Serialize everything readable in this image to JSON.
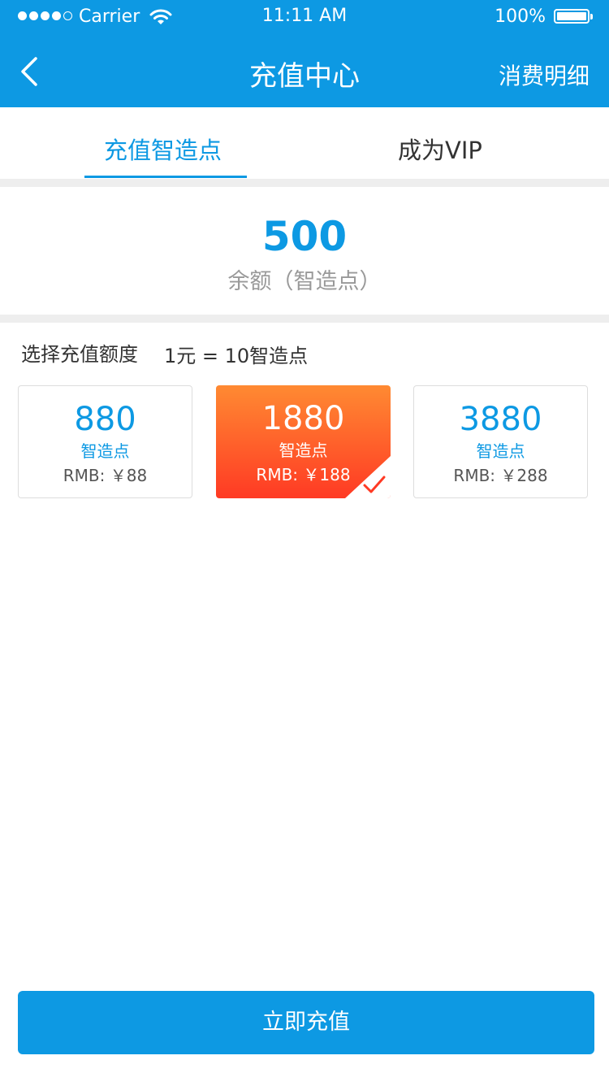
{
  "status_bar": {
    "carrier": "Carrier",
    "time": "11:11 AM",
    "battery": "100%",
    "signal_bars": 4,
    "signal_total": 5
  },
  "nav": {
    "title": "充值中心",
    "right_action": "消费明细"
  },
  "tabs": [
    {
      "label": "充值智造点",
      "active": true
    },
    {
      "label": "成为VIP",
      "active": false
    }
  ],
  "balance": {
    "value": "500",
    "label": "余额（智造点）"
  },
  "recharge": {
    "select_label": "选择充值额度",
    "rate": "1元 = 10智造点",
    "options": [
      {
        "amount": "880",
        "unit": "智造点",
        "price": "RMB: ￥88",
        "selected": false
      },
      {
        "amount": "1880",
        "unit": "智造点",
        "price": "RMB: ￥188",
        "selected": true
      },
      {
        "amount": "3880",
        "unit": "智造点",
        "price": "RMB: ￥288",
        "selected": false
      }
    ]
  },
  "cta_label": "立即充值",
  "colors": {
    "primary": "#0d99e3",
    "selected_gradient_top": "#ff8a32",
    "selected_gradient_bottom": "#ff3a24",
    "divider": "#eeeeee"
  }
}
